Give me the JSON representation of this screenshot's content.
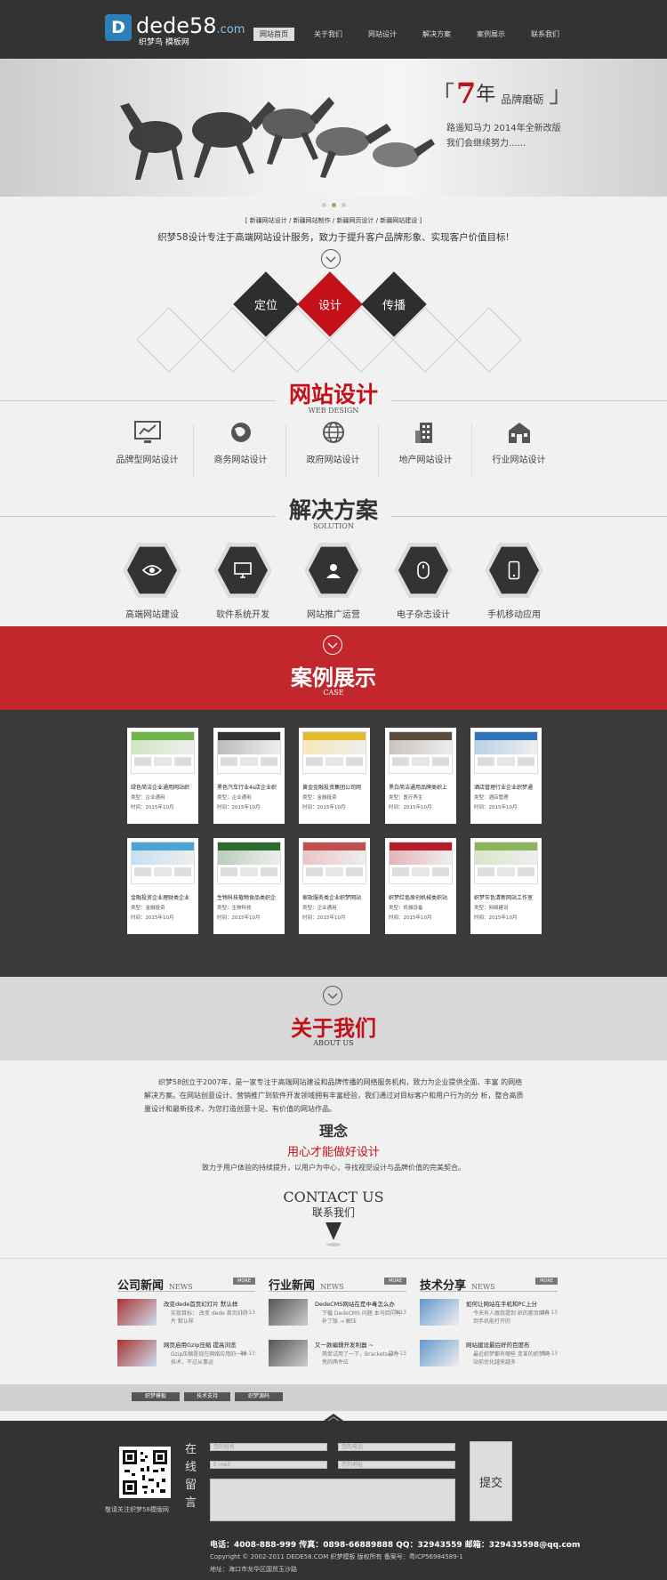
{
  "header": {
    "logo": {
      "text": "dede58",
      "suffix": ".com",
      "subtitle": "织梦鸟  模板网"
    },
    "nav": [
      {
        "label": "网站首页",
        "active": true
      },
      {
        "label": "关于我们"
      },
      {
        "label": "网站设计"
      },
      {
        "label": "解决方案"
      },
      {
        "label": "案例展示"
      },
      {
        "label": "联系我们"
      }
    ]
  },
  "banner": {
    "years": "7",
    "unit": "年",
    "tag": "品牌磨砺",
    "line1": "路遥知马力  2014年全新改版",
    "line2": "我们会继续努力......",
    "slide_count": 3,
    "active_slide": 2
  },
  "intro": {
    "tags": "[ 新疆网站设计 / 新疆网站制作 / 新疆网页设计 / 新疆网站建设 ]",
    "text": "织梦58设计专注于高端网站设计服务，致力于提升客户品牌形象、实现客户价值目标!"
  },
  "steps": [
    "定位",
    "设计",
    "传播"
  ],
  "web_design": {
    "title": "网站设计",
    "subtitle": "WEB DESIGN",
    "items": [
      {
        "label": "品牌型网站设计",
        "icon": "chart-monitor-icon"
      },
      {
        "label": "商务网站设计",
        "icon": "globe-icon"
      },
      {
        "label": "政府网站设计",
        "icon": "world-grid-icon"
      },
      {
        "label": "地产网站设计",
        "icon": "building-icon"
      },
      {
        "label": "行业网站设计",
        "icon": "factory-icon"
      }
    ]
  },
  "solution": {
    "title": "解决方案",
    "subtitle": "SOLUTION",
    "items": [
      {
        "label": "高端网站建设",
        "icon": "eye-icon"
      },
      {
        "label": "软件系统开发",
        "icon": "monitor-icon"
      },
      {
        "label": "网站推广运营",
        "icon": "user-icon"
      },
      {
        "label": "电子杂志设计",
        "icon": "mouse-icon"
      },
      {
        "label": "手机移动应用",
        "icon": "phone-icon"
      }
    ]
  },
  "cases": {
    "title": "案例展示",
    "subtitle": "CASE",
    "items": [
      {
        "title": "绿色简洁企业通用网站织",
        "type": "类型：企业通用",
        "time": "时间：2015年10月",
        "color": "#6fb44a"
      },
      {
        "title": "黑色汽车行业4s店企业织",
        "type": "类型：企业通用",
        "time": "时间：2015年10月",
        "color": "#333333"
      },
      {
        "title": "黄金金融投资集团公司网",
        "type": "类型：金融投资",
        "time": "时间：2015年10月",
        "color": "#e4b92c"
      },
      {
        "title": "黑白简洁通用品牌类织上",
        "type": "类型：医疗养生",
        "time": "时间：2015年10月",
        "color": "#5a4a3a"
      },
      {
        "title": "酒店管理行业企业织梦通",
        "type": "类型：酒店管理",
        "time": "时间：2015年10月",
        "color": "#2f73b8"
      },
      {
        "title": "金融投资企业理财类企业",
        "type": "类型：金融投资",
        "time": "时间：2015年10月",
        "color": "#4ba3d6"
      },
      {
        "title": "生物科技植物食品类织企",
        "type": "类型：生物科技",
        "time": "时间：2015年10月",
        "color": "#2d6a2d"
      },
      {
        "title": "家政服务类企业织梦网站",
        "type": "类型：企业通用",
        "time": "时间：2015年10月",
        "color": "#c05050"
      },
      {
        "title": "织梦红色原创机械类织站",
        "type": "类型：机械设备",
        "time": "时间：2015年10月",
        "color": "#b51d2a"
      },
      {
        "title": "织梦灰色清新网站工作室",
        "type": "类型：网络建设",
        "time": "时间：2015年10月",
        "color": "#8ab55a"
      }
    ]
  },
  "about": {
    "title": "关于我们",
    "subtitle": "ABOUT US",
    "p1": "织梦58创立于2007年，是一家专注于高端网站建设和品牌传播的网络服务机构，致力为企业提供全面、丰富 的网络解决方案。在网站创意设计、营销推广到软件开发领域拥有丰富经验，我们通过对目标客户和用户行为的分 析，整合高质量设计和最新技术，为您打造创意十足、有价值的网站作品。",
    "idea_title": "理念",
    "idea_slogan": "用心才能做好设计",
    "idea_text": "致力于用户体验的持续提升，以用户为中心，寻找视觉设计与品牌价值的完美契合。"
  },
  "contact": {
    "en": "CONTACT US",
    "cn": "联系我们"
  },
  "news": [
    {
      "title": "公司新闻",
      "en": "NEWS",
      "more": "MORE",
      "items": [
        {
          "title": "改变dede首页幻灯片 默认样",
          "desc": "实现目标：  改变 dede 首页幻灯片 默认样",
          "date": "10-13"
        },
        {
          "title": "网页启用Gzip压缩 提高浏览",
          "desc": "Gzip压缩是现在网络应用的一种技术，不过从事运",
          "date": "10-13"
        }
      ]
    },
    {
      "title": "行业新闻",
      "en": "NEWS",
      "more": "MORE",
      "items": [
        {
          "title": "DedeCMS网站在是中毒怎么办",
          "desc": "下载 DedeCMS 问题 本马回门有补丁版 → 解压",
          "date": "10-13"
        },
        {
          "title": "又一款编辑开发利器 ~",
          "desc": "简单试用了一下，Brackets最为亮的两件应",
          "date": "10-13"
        }
      ]
    },
    {
      "title": "技术分享",
      "en": "NEWS",
      "more": "MORE",
      "items": [
        {
          "title": "如何让网站在手机和PC上分",
          "desc": "今天有人跟我提到 织的那页面有到手机能打开的",
          "date": "10-13"
        },
        {
          "title": "网站建设最后好的百度布",
          "desc": "最近织梦都有哪些 变革的织梦网站前优化越来越多",
          "date": "10-13"
        }
      ]
    }
  ],
  "friend_links": [
    "织梦模板",
    "技术支持",
    "织梦源码"
  ],
  "footer": {
    "qr_caption": "敬请关注织梦58模版网",
    "form_title": "在线留言",
    "fields": [
      "您的姓名",
      "您的电话",
      "E-mail",
      "您的地址"
    ],
    "submit": "提交",
    "line1": "电话：4008-888-999    传真：0898-66889888    QQ：32943559    邮箱：329435598@qq.com",
    "line2": "Copyright © 2002-2011 DEDE58.COM 织梦模板 版权所有 备案号：粤ICP56984589-1",
    "line3": "地址：海口市龙华区国贸玉沙路"
  },
  "colors": {
    "accent": "#c41018",
    "dark": "#333333",
    "case_bg": "#3b3b3b"
  }
}
